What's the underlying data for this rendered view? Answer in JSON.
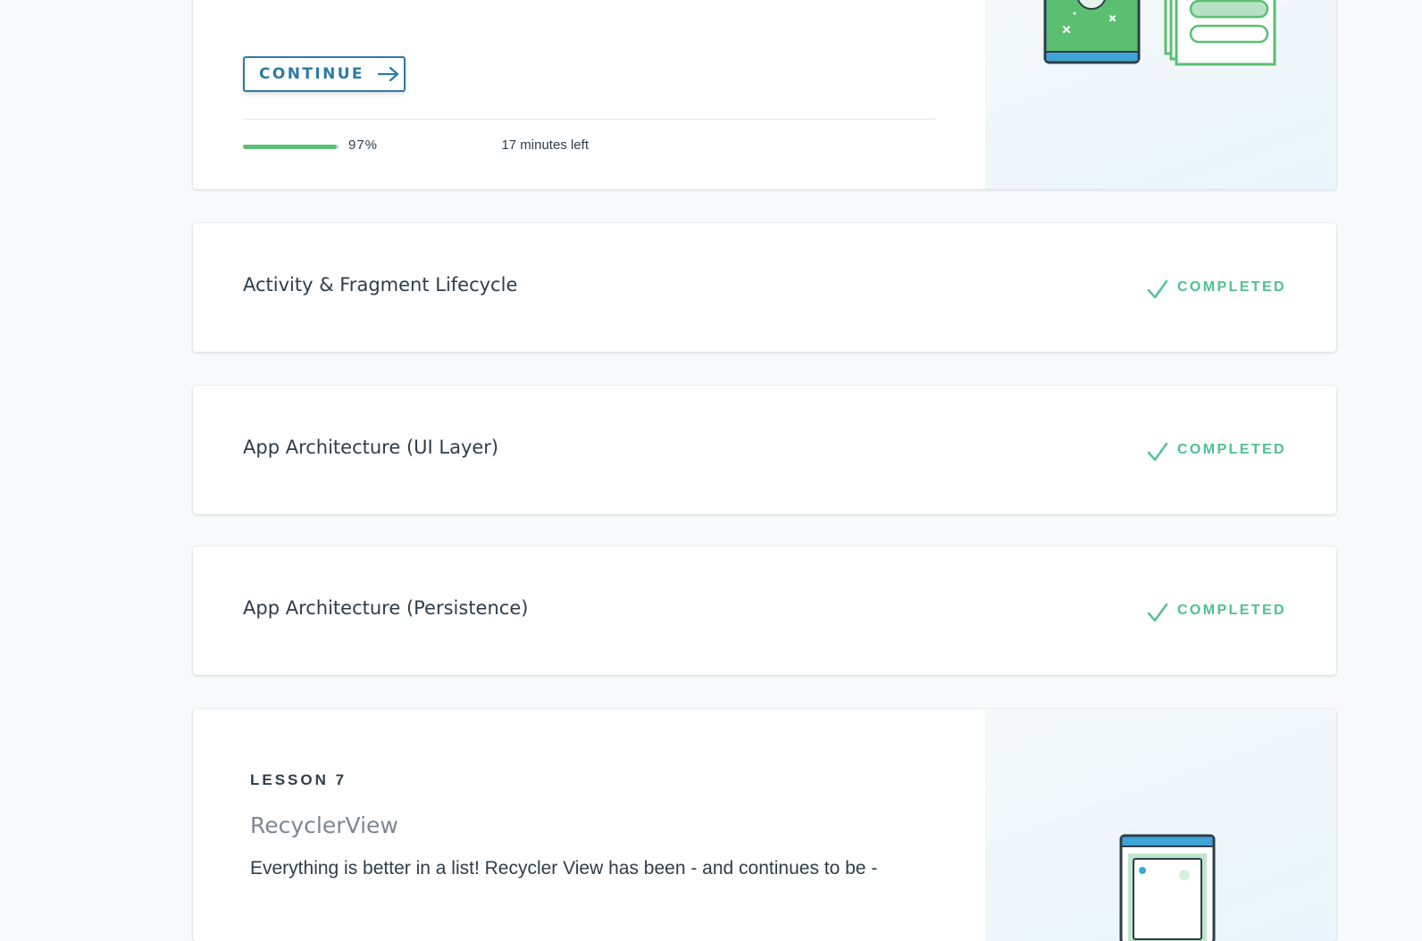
{
  "current_lesson": {
    "continue_label": "CONTINUE",
    "progress_percent": 97,
    "progress_text": "97%",
    "time_left": "17 minutes left"
  },
  "completed_lessons": [
    {
      "title": "Activity & Fragment Lifecycle",
      "status": "COMPLETED"
    },
    {
      "title": "App Architecture (UI Layer)",
      "status": "COMPLETED"
    },
    {
      "title": "App Architecture (Persistence)",
      "status": "COMPLETED"
    }
  ],
  "next_lesson": {
    "number_label": "LESSON 7",
    "title": "RecyclerView",
    "description": "Everything is better in a list! Recycler View has been - and continues to be -"
  },
  "colors": {
    "accent_blue": "#2d7aa2",
    "progress_green": "#5dbf76",
    "completed_green": "#4fc18f",
    "text_dark": "#2e3d49"
  },
  "icons": {
    "continue_arrow": "arrow-right-icon",
    "completed_check": "checkmark-icon"
  }
}
